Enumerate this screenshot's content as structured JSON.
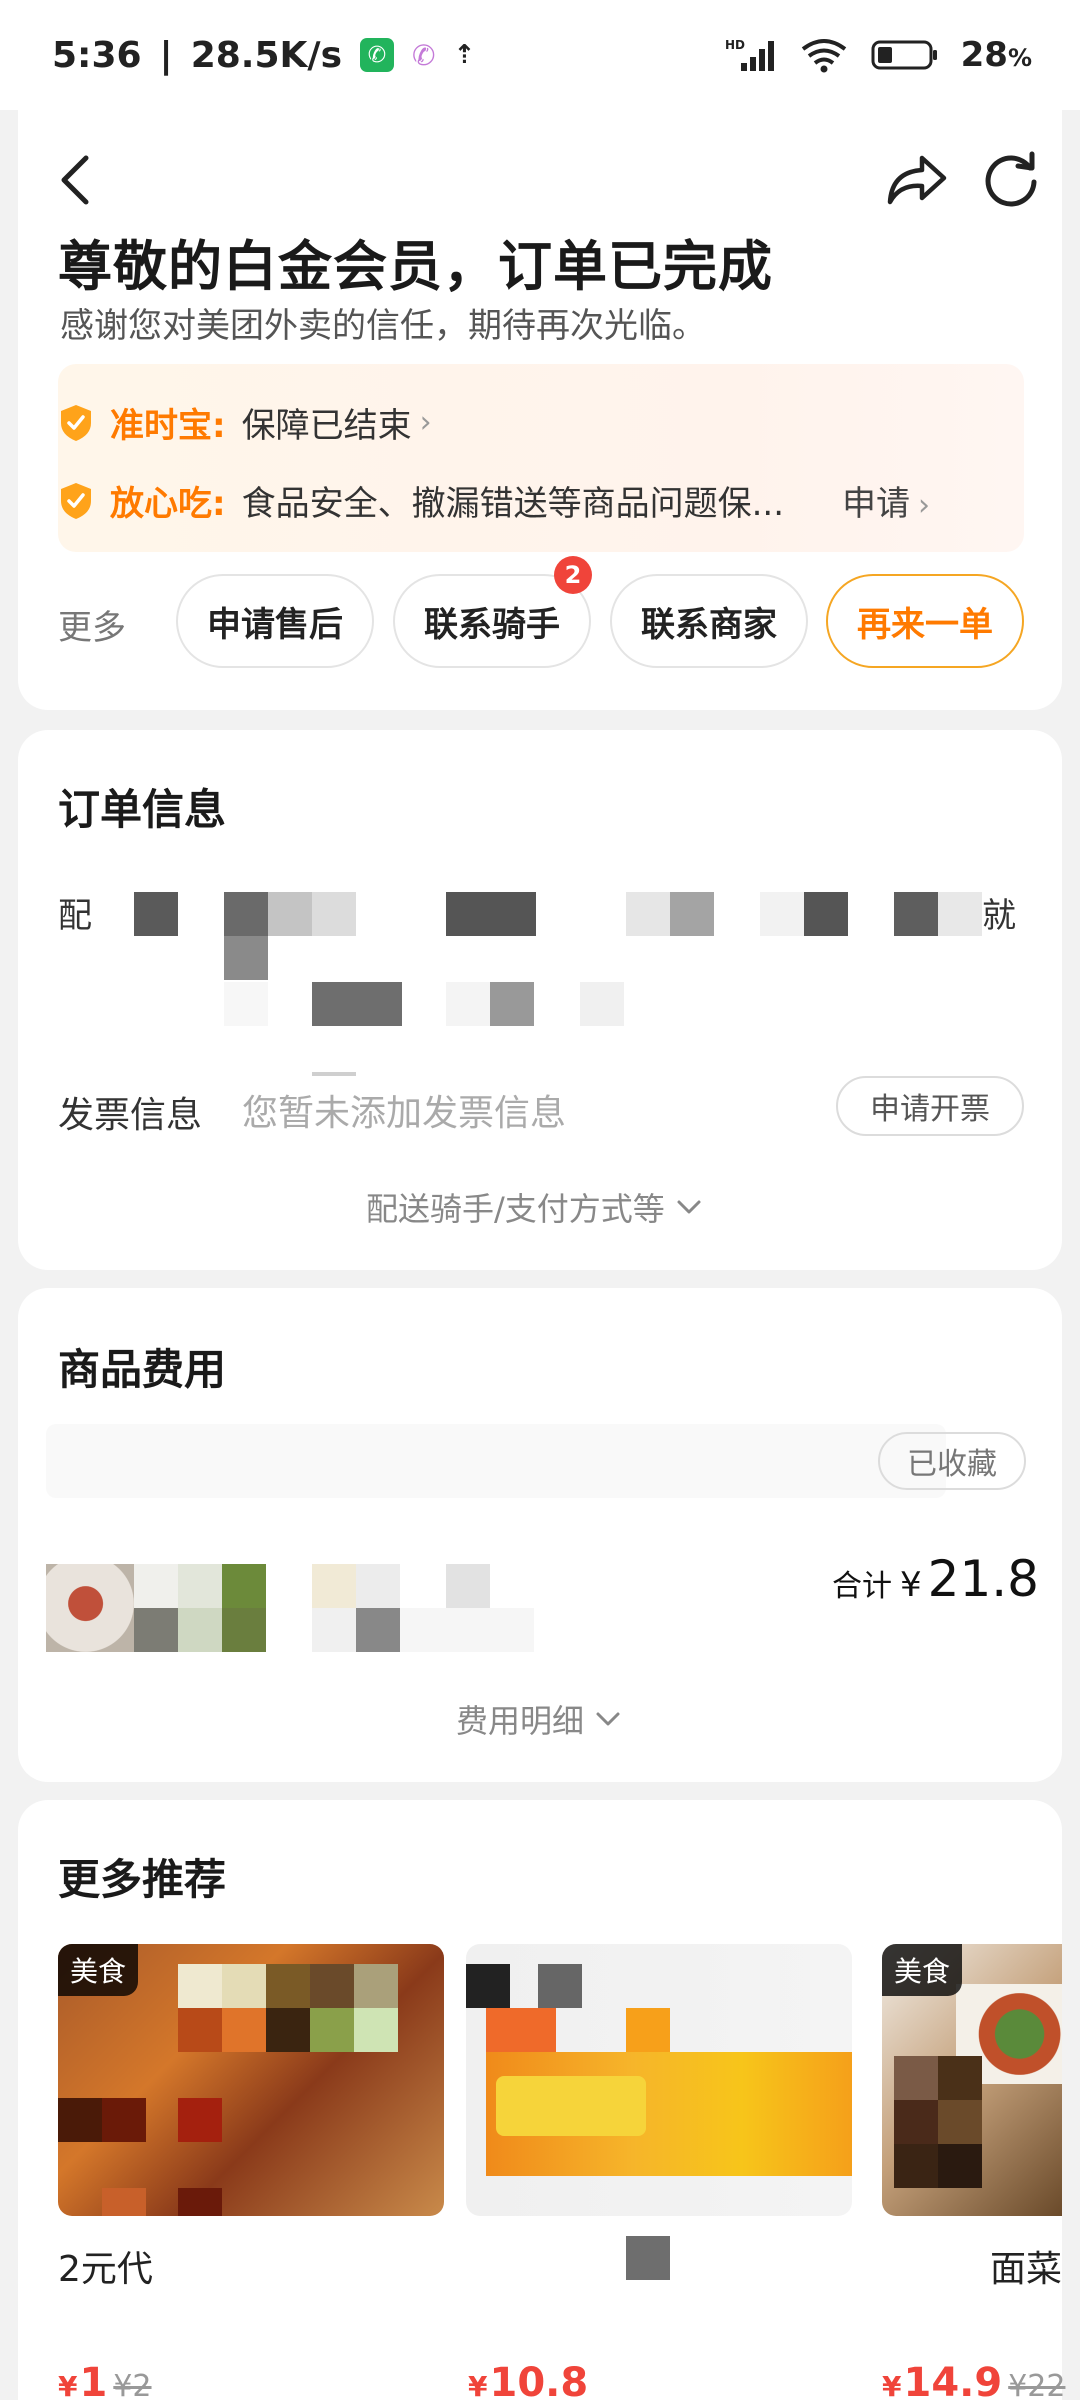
{
  "status_bar": {
    "time": "5:36",
    "speed": "28.5K/s",
    "battery": "28",
    "battery_unit": "%",
    "icons": [
      "phone-call-icon",
      "missed-call-icon",
      "person-up-icon",
      "hd-signal-icon",
      "wifi-icon",
      "battery-icon"
    ]
  },
  "header": {
    "title": "尊敬的白金会员，订单已完成",
    "subtitle": "感谢您对美团外卖的信任，期待再次光临。"
  },
  "guarantees": [
    {
      "label": "准时宝:",
      "text": "保障已结束"
    },
    {
      "label": "放心吃:",
      "text": "食品安全、撤漏错送等商品问题保...",
      "action": "申请"
    }
  ],
  "actions": {
    "more_label": "更多",
    "buttons": [
      "申请售后",
      "联系骑手",
      "联系商家",
      "再来一单"
    ],
    "rider_badge": "2"
  },
  "order_info": {
    "title": "订单信息",
    "partial_left": "配",
    "partial_right": "就",
    "invoice_label": "发票信息",
    "invoice_value": "您暂未添加发票信息",
    "invoice_button": "申请开票",
    "expand_label": "配送骑手/支付方式等"
  },
  "fees": {
    "title": "商品费用",
    "collect_button": "已收藏",
    "total_label": "合计",
    "currency": "¥",
    "total_value": "21.8",
    "detail_label": "费用明细"
  },
  "recommend": {
    "title": "更多推荐",
    "items": [
      {
        "tag": "美食",
        "name": "2元代",
        "currency": "¥",
        "price": "1",
        "old_price": "¥2"
      },
      {
        "tag": "",
        "name": "",
        "currency": "¥",
        "price": "10.8",
        "old_price": ""
      },
      {
        "tag": "美食",
        "name": "面菜",
        "currency": "¥",
        "price": "14.9",
        "old_price": "¥22"
      }
    ]
  },
  "colors": {
    "accent_orange": "#ff7a00",
    "price_red": "#f0443a",
    "background": "#f2f2f2"
  }
}
